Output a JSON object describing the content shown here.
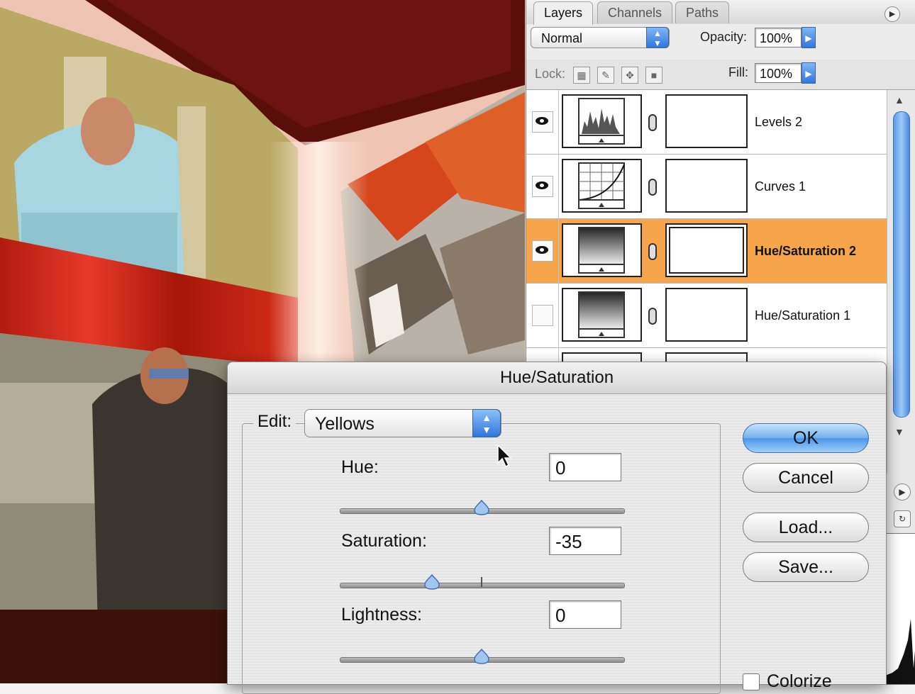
{
  "layers_panel": {
    "tabs": [
      "Layers",
      "Channels",
      "Paths"
    ],
    "blend_mode": "Normal",
    "opacity_label": "Opacity:",
    "opacity_value": "100%",
    "lock_label": "Lock:",
    "fill_label": "Fill:",
    "fill_value": "100%",
    "layers": [
      {
        "name": "Levels 2",
        "visible": true,
        "selected": false,
        "icon": "levels-icon"
      },
      {
        "name": "Curves 1",
        "visible": true,
        "selected": false,
        "icon": "curves-icon"
      },
      {
        "name": "Hue/Saturation 2",
        "visible": true,
        "selected": true,
        "icon": "hue-saturation-icon"
      },
      {
        "name": "Hue/Saturation 1",
        "visible": false,
        "selected": false,
        "icon": "hue-saturation-icon"
      }
    ]
  },
  "dialog": {
    "title": "Hue/Saturation",
    "edit_label": "Edit:",
    "edit_value": "Yellows",
    "hue_label": "Hue:",
    "hue_value": "0",
    "saturation_label": "Saturation:",
    "saturation_value": "-35",
    "lightness_label": "Lightness:",
    "lightness_value": "0",
    "buttons": {
      "ok": "OK",
      "cancel": "Cancel",
      "load": "Load...",
      "save": "Save..."
    },
    "colorize_label": "Colorize",
    "colorize_checked": false,
    "slider_ranges": {
      "hue": [
        -180,
        180
      ],
      "saturation": [
        -100,
        100
      ],
      "lightness": [
        -100,
        100
      ]
    }
  },
  "colors": {
    "selected_layer": "#f7a54a",
    "default_button": "#4b96e8",
    "scroll_thumb": "#5b9ce8"
  }
}
